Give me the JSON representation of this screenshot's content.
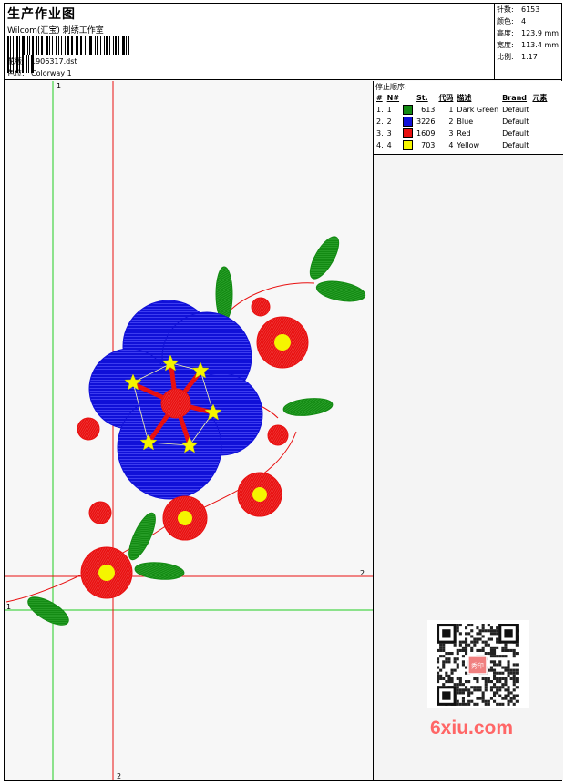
{
  "header": {
    "title": "生产作业图",
    "company": "Wilcom(汇宝) 刺绣工作室",
    "fields": [
      {
        "label": "花版:",
        "value": "1906317.dst"
      },
      {
        "label": "色位:",
        "value": "Colorway 1"
      }
    ]
  },
  "stats": [
    {
      "label": "针数:",
      "value": "6153"
    },
    {
      "label": "颜色:",
      "value": "4"
    },
    {
      "label": "高度:",
      "value": "123.9 mm"
    },
    {
      "label": "宽度:",
      "value": "113.4 mm"
    },
    {
      "label": "比例:",
      "value": "1.17"
    }
  ],
  "sequence": {
    "caption": "停止顺序:",
    "headers": [
      "#",
      "N#",
      "St.",
      "代码",
      "描述",
      "Brand",
      "元素"
    ],
    "rows": [
      {
        "n": "1.",
        "nn": "1",
        "color": "#138a13",
        "st": "613",
        "code": "1",
        "desc": "Dark Green",
        "brand": "Default"
      },
      {
        "n": "2.",
        "nn": "2",
        "color": "#1010d8",
        "st": "3226",
        "code": "2",
        "desc": "Blue",
        "brand": "Default"
      },
      {
        "n": "3.",
        "nn": "3",
        "color": "#e81010",
        "st": "1609",
        "code": "3",
        "desc": "Red",
        "brand": "Default"
      },
      {
        "n": "4.",
        "nn": "4",
        "color": "#f5f500",
        "st": "703",
        "code": "4",
        "desc": "Yellow",
        "brand": "Default"
      }
    ]
  },
  "guides": {
    "green_label": "1",
    "red_label": "2"
  },
  "watermark": {
    "text": "6xiu.com",
    "qr_text": "秀印"
  }
}
